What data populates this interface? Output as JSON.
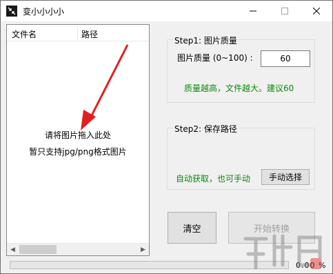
{
  "window": {
    "title": "变小小小小"
  },
  "file_list": {
    "columns": [
      "文件名",
      "路径"
    ],
    "hint_line1": "请将图片拖入此处",
    "hint_line2": "暂只支持jpg/png格式图片"
  },
  "step1": {
    "title": "Step1: 图片质量",
    "quality_label": "图片质量 (0~100) :",
    "quality_value": "60",
    "hint": "质量越高，文件越大。建议60"
  },
  "step2": {
    "title": "Step2: 保存路径",
    "auto_text": "自动获取，也可手动",
    "manual_button": "手动选择"
  },
  "actions": {
    "clear_label": "清空",
    "start_label": "开始转换"
  },
  "progress": {
    "value": 0,
    "text": "0.00 %"
  },
  "colors": {
    "hint_green": "#0a8a0a",
    "arrow_red": "#e02020",
    "progress_green": "#06b025"
  }
}
